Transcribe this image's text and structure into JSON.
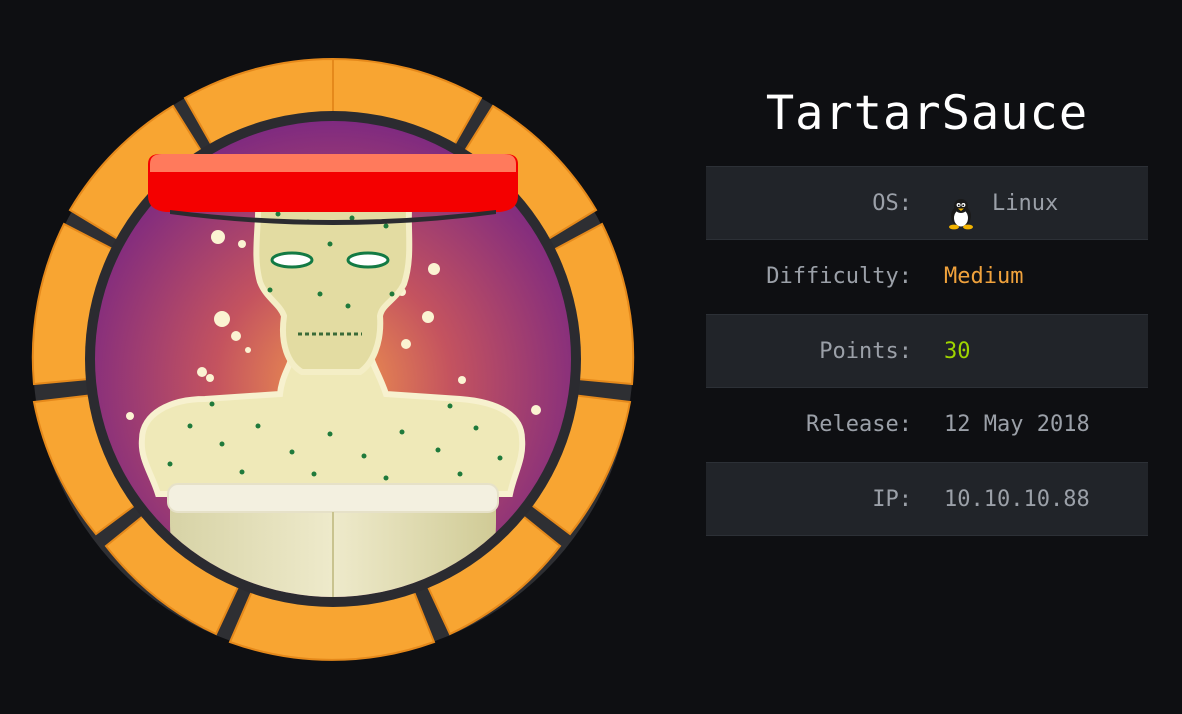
{
  "machine": {
    "name": "TartarSauce",
    "badge_icon": "tartar-sauce-jar-avatar"
  },
  "info_rows": {
    "os": {
      "label": "OS:",
      "value": "Linux",
      "icon": "tux-penguin-icon"
    },
    "difficulty": {
      "label": "Difficulty:",
      "value": "Medium",
      "color": "#f0a23c"
    },
    "points": {
      "label": "Points:",
      "value": "30",
      "color": "#9fd400"
    },
    "release": {
      "label": "Release:",
      "value": "12 May 2018"
    },
    "ip": {
      "label": "IP:",
      "value": "10.10.10.88"
    }
  },
  "colors": {
    "background": "#0e0f12",
    "row_shaded": "#212429",
    "label_text": "#9ba0a8",
    "badge_ring": "#f8a532",
    "badge_inner": "#8a2f82"
  }
}
